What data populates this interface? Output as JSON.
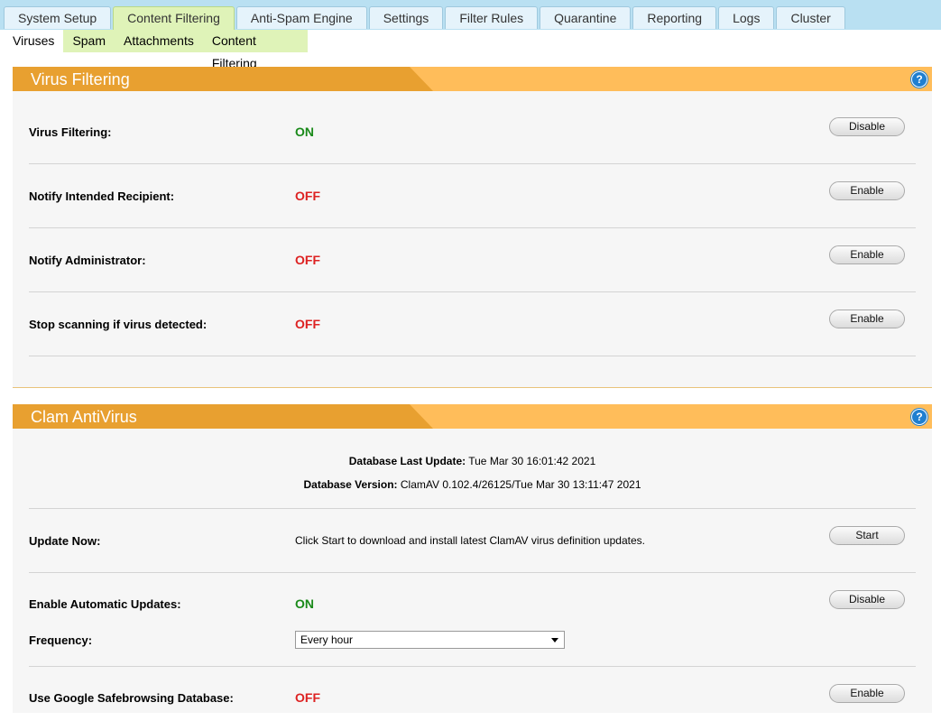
{
  "tabs": [
    "System Setup",
    "Content Filtering",
    "Anti-Spam Engine",
    "Settings",
    "Filter Rules",
    "Quarantine",
    "Reporting",
    "Logs",
    "Cluster"
  ],
  "active_tab": "Content Filtering",
  "subtabs": [
    "Viruses",
    "Spam",
    "Attachments",
    "Content Filtering"
  ],
  "active_subtab": "Viruses",
  "virus_panel": {
    "title": "Virus Filtering",
    "help": "?",
    "rows": [
      {
        "label": "Virus Filtering:",
        "value": "ON",
        "button": "Disable"
      },
      {
        "label": "Notify Intended Recipient:",
        "value": "OFF",
        "button": "Enable"
      },
      {
        "label": "Notify Administrator:",
        "value": "OFF",
        "button": "Enable"
      },
      {
        "label": "Stop scanning if virus detected:",
        "value": "OFF",
        "button": "Enable"
      }
    ]
  },
  "clam_panel": {
    "title": "Clam AntiVirus",
    "help": "?",
    "db_update_label": "Database Last Update:",
    "db_update_value": "Tue Mar 30 16:01:42 2021",
    "db_version_label": "Database Version:",
    "db_version_value": "ClamAV 0.102.4/26125/Tue Mar 30 13:11:47 2021",
    "update_now": {
      "label": "Update Now:",
      "text": "Click Start to download and install latest ClamAV virus definition updates.",
      "button": "Start"
    },
    "auto_updates": {
      "label": "Enable Automatic Updates:",
      "value": "ON",
      "button": "Disable"
    },
    "frequency": {
      "label": "Frequency:",
      "selected": "Every hour"
    },
    "safebrowsing": {
      "label": "Use Google Safebrowsing Database:",
      "value": "OFF",
      "button": "Enable"
    }
  },
  "colors": {
    "on": "#1a8a1a",
    "off": "#dd2222",
    "panel_header": "#ffbd5a",
    "panel_title_bg": "#e8a030",
    "top_bar": "#b9e0f2",
    "sub_bar": "#dff3b8"
  }
}
